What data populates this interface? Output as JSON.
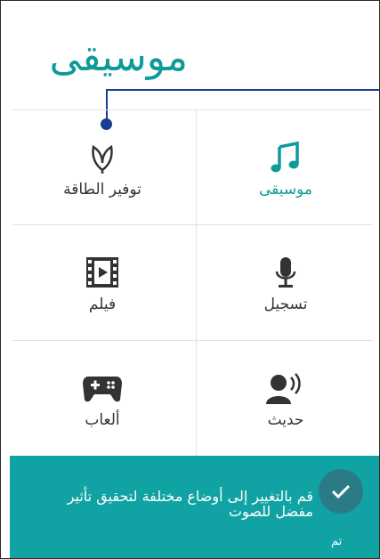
{
  "header": {
    "title": "موسيقى"
  },
  "modes": [
    {
      "label": "موسيقى",
      "icon": "music-note-icon",
      "active": true
    },
    {
      "label": "توفير الطاقة",
      "icon": "leaf-icon",
      "active": false
    },
    {
      "label": "تسجيل",
      "icon": "microphone-icon",
      "active": false
    },
    {
      "label": "فيلم",
      "icon": "film-icon",
      "active": false
    },
    {
      "label": "حديث",
      "icon": "speaking-person-icon",
      "active": false
    },
    {
      "label": "ألعاب",
      "icon": "gamepad-icon",
      "active": false
    }
  ],
  "tip": {
    "text": "قم بالتغيير إلى أوضاع مختلفة لتحقيق تأثير مفضل للصوت",
    "done_label": "تم",
    "done_icon": "checkmark-icon"
  },
  "colors": {
    "accent": "#0f9a9a",
    "bar": "#11a3a3",
    "callout": "#1a3d8f",
    "icon": "#333333"
  }
}
